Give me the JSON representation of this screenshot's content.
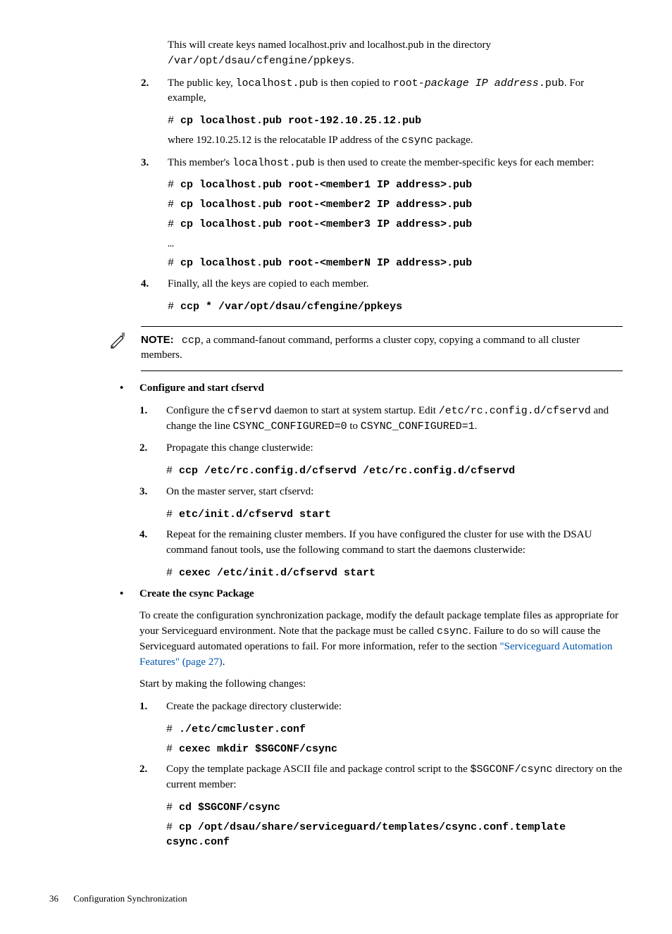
{
  "step1_para1_a": "This will create keys named localhost.priv and localhost.pub in the directory ",
  "step1_para1_b": "/var/opt/dsau/cfengine/ppkeys",
  "step1_para1_c": ".",
  "item2_marker": "2.",
  "item2_text_a": "The public key, ",
  "item2_text_b": "localhost.pub",
  "item2_text_c": " is then copied to ",
  "item2_text_d": "root-",
  "item2_text_e": "package IP address",
  "item2_text_f": ".pub",
  "item2_text_g": ". For example,",
  "item2_code_prefix": "# ",
  "item2_code": "cp localhost.pub root-192.10.25.12.pub",
  "item2_after_a": "where 192.10.25.12 is the relocatable IP address of the ",
  "item2_after_b": "csync",
  "item2_after_c": " package.",
  "item3_marker": "3.",
  "item3_text_a": "This member's ",
  "item3_text_b": "localhost.pub",
  "item3_text_c": " is then used to create the member-specific keys for each member:",
  "item3_code1_prefix": "# ",
  "item3_code1": "cp localhost.pub root-<member1 IP address>.pub",
  "item3_code2_prefix": "# ",
  "item3_code2": "cp localhost.pub root-<member2 IP address>.pub",
  "item3_code3_prefix": "# ",
  "item3_code3": "cp localhost.pub root-<member3 IP address>.pub",
  "item3_ellipsis": "…",
  "item3_codeN_prefix": "# ",
  "item3_codeN": "cp localhost.pub root-<memberN IP address>.pub",
  "item4_marker": "4.",
  "item4_text": "Finally, all the keys are copied to each member.",
  "item4_code_prefix": "# ",
  "item4_code": "ccp * /var/opt/dsau/cfengine/ppkeys",
  "note_label": "NOTE:",
  "note_text_a": "ccp",
  "note_text_b": ", a command-fanout command, performs a cluster copy, copying a command to all cluster members.",
  "bullet1_title": "Configure and start cfservd",
  "b1_item1_marker": "1.",
  "b1_item1_a": "Configure the ",
  "b1_item1_b": "cfservd",
  "b1_item1_c": " daemon to start at system startup. Edit ",
  "b1_item1_d": "/etc/rc.config.d/cfservd",
  "b1_item1_e": " and change the line ",
  "b1_item1_f": "CSYNC_CONFIGURED=0",
  "b1_item1_g": " to  ",
  "b1_item1_h": "CSYNC_CONFIGURED=1",
  "b1_item1_i": ".",
  "b1_item2_marker": "2.",
  "b1_item2_text": "Propagate this change clusterwide:",
  "b1_item2_code_prefix": "# ",
  "b1_item2_code": "ccp /etc/rc.config.d/cfservd /etc/rc.config.d/cfservd",
  "b1_item3_marker": "3.",
  "b1_item3_text": "On the master server, start cfservd:",
  "b1_item3_code_prefix": "# ",
  "b1_item3_code": "etc/init.d/cfservd start",
  "b1_item4_marker": "4.",
  "b1_item4_text": "Repeat for the remaining cluster members. If you have configured the cluster for use with the DSAU command fanout tools, use the following command to start the daemons clusterwide:",
  "b1_item4_code_prefix": "# ",
  "b1_item4_code": "cexec /etc/init.d/cfservd start",
  "bullet2_title": "Create the csync Package",
  "b2_para1_a": "To create the configuration  synchronization package, modify the default package template files as appropriate for your Serviceguard environment. Note that the package must be called ",
  "b2_para1_b": "csync",
  "b2_para1_c": ". Failure to do so will cause the Serviceguard automated operations to fail. For more information, refer to the section ",
  "b2_para1_link": "\"Serviceguard Automation Features\" (page 27)",
  "b2_para1_d": ".",
  "b2_para2": "Start by making the following changes:",
  "b2_item1_marker": "1.",
  "b2_item1_text": "Create the package directory clusterwide:",
  "b2_item1_code1_prefix": "# ",
  "b2_item1_code1": "./etc/cmcluster.conf",
  "b2_item1_code2_prefix": "# ",
  "b2_item1_code2": "cexec mkdir $SGCONF/csync",
  "b2_item2_marker": "2.",
  "b2_item2_text_a": "Copy the template package ASCII file and package control script to the ",
  "b2_item2_text_b": "$SGCONF/csync",
  "b2_item2_text_c": " directory on the current member:",
  "b2_item2_code1_prefix": "# ",
  "b2_item2_code1": "cd $SGCONF/csync",
  "b2_item2_code2_prefix": "# ",
  "b2_item2_code2": "cp /opt/dsau/share/serviceguard/templates/csync.conf.template csync.conf",
  "footer_page": "36",
  "footer_title": "Configuration Synchronization"
}
